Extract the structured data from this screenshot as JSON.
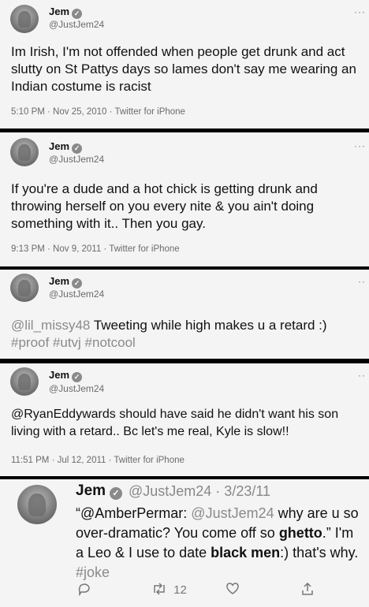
{
  "tweets": [
    {
      "name": "Jem",
      "handle": "@JustJem24",
      "text": "Im Irish, I'm not offended when people get drunk and act slutty on St Pattys days so lames don't say me wearing an Indian costume is racist",
      "meta": "5:10 PM · Nov 25, 2010 · Twitter for iPhone"
    },
    {
      "name": "Jem",
      "handle": "@JustJem24",
      "text": "If you're a dude and a hot chick is getting drunk and throwing herself on you every nite & you ain't doing something with it.. Then you gay.",
      "meta": "9:13 PM · Nov 9, 2011 · Twitter for iPhone"
    },
    {
      "name": "Jem",
      "handle": "@JustJem24",
      "mention": "@lil_missy48",
      "text": "Tweeting while high makes u a retard :)",
      "hashtags": "#proof #utvj #notcool"
    },
    {
      "name": "Jem",
      "handle": "@JustJem24",
      "text": "@RyanEddywards should have said he didn't want his son living with a retard.. Bc let's me real, Kyle is  slow!!",
      "meta": "11:51 PM · Jul 12, 2011 · Twitter for iPhone"
    },
    {
      "name": "Jem",
      "handle_date": "@JustJem24 · 3/23/11",
      "open_quote": "“@AmberPermar: ",
      "quoted_handle": "@JustJem24",
      "part1": " why are u so over-dramatic? You come off so ",
      "bold1": "ghetto",
      "part2": ".” I'm a Leo & I use to date ",
      "bold2": "black men",
      "part3": ":) that's why. ",
      "hashtag": "#joke",
      "retweet_count": "12"
    }
  ],
  "icons": {
    "verified": "verified-badge-icon",
    "more": "more-options-icon",
    "reply": "reply-icon",
    "retweet": "retweet-icon",
    "like": "like-icon",
    "share": "share-icon"
  },
  "colors": {
    "card_background": "#f4f4f4",
    "separator": "#000000",
    "link_gray": "#8a8a8a"
  }
}
